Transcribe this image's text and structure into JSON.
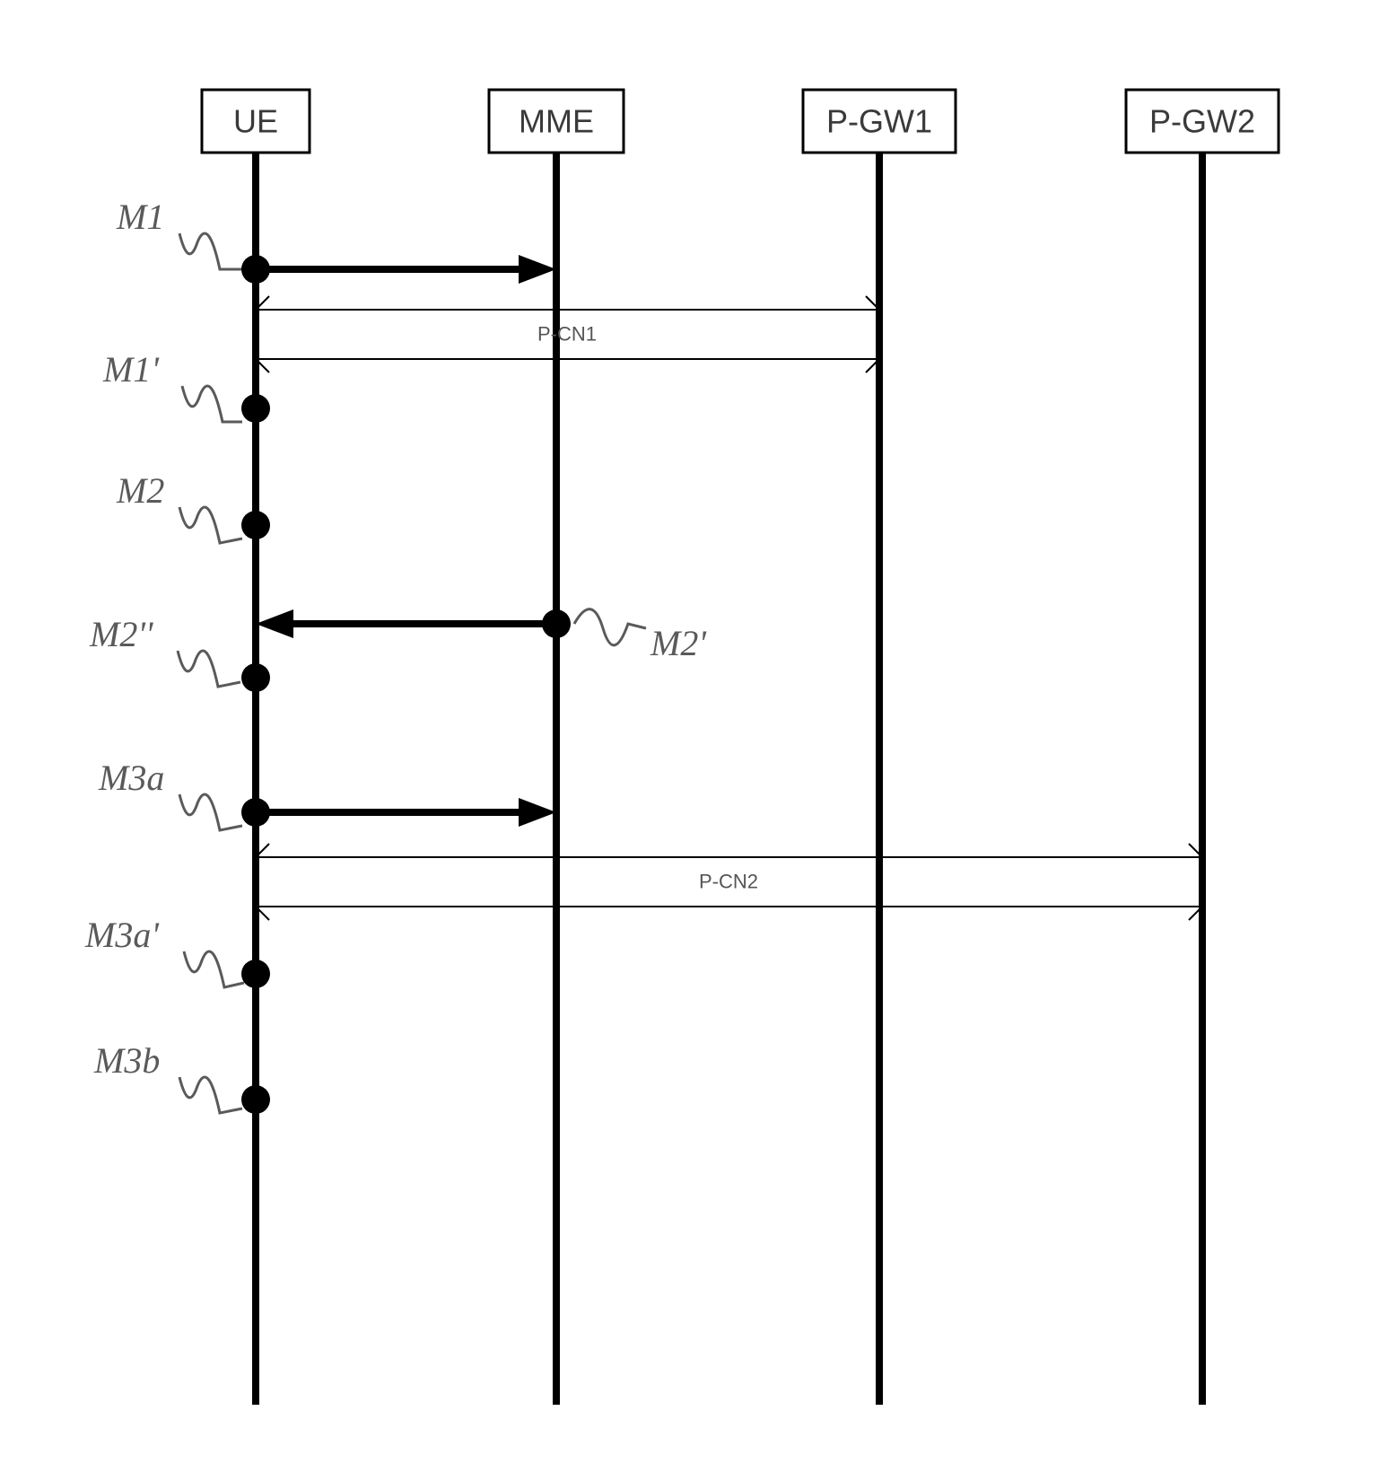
{
  "actors": {
    "ue": "UE",
    "mme": "MME",
    "pgw1": "P-GW1",
    "pgw2": "P-GW2"
  },
  "bands": {
    "b1": "P-CN1",
    "b2": "P-CN2"
  },
  "events": {
    "m1": "M1",
    "m1_prime": "M1'",
    "m2": "M2",
    "m2_prime": "M2'",
    "m2_dprime": "M2''",
    "m3a": "M3a",
    "m3a_prime": "M3a'",
    "m3b": "M3b"
  }
}
